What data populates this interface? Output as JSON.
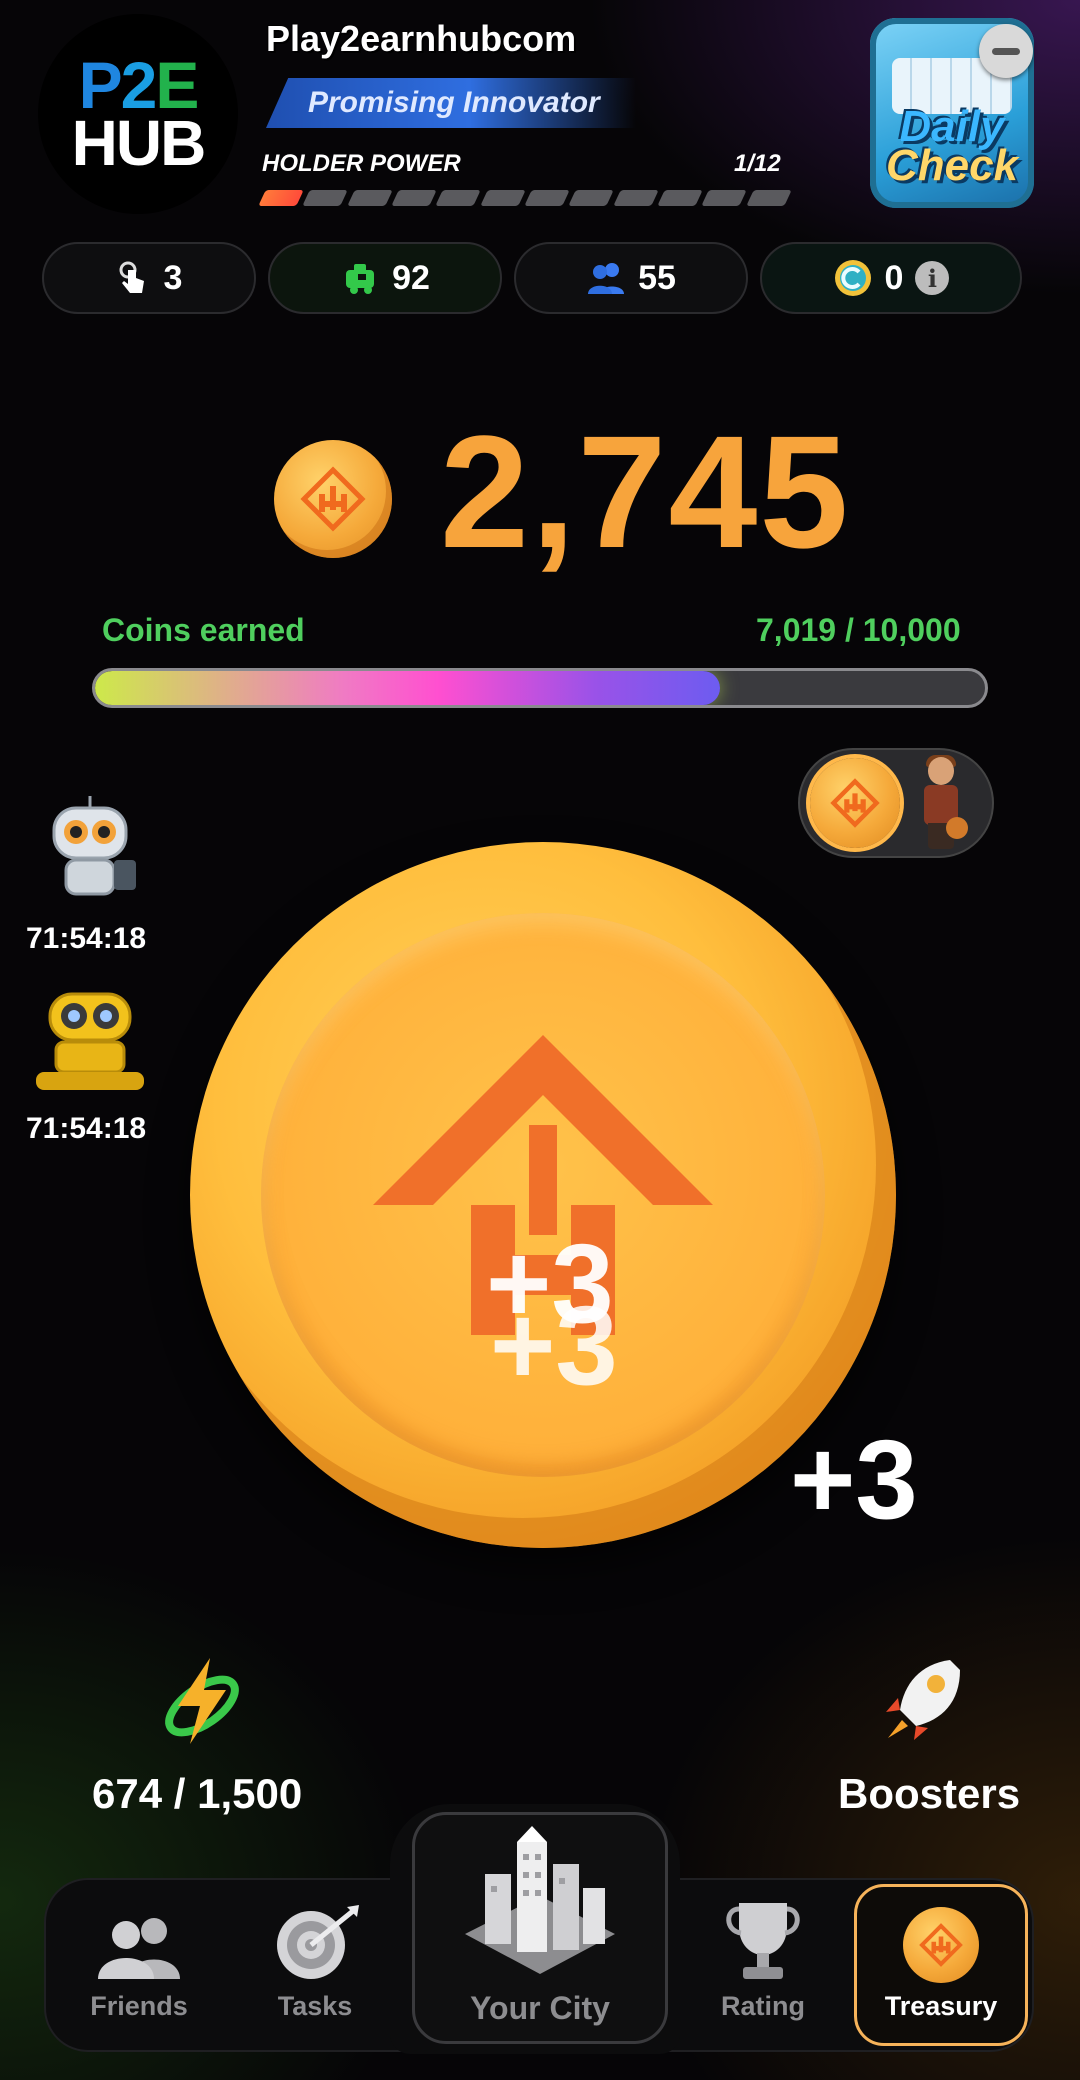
{
  "header": {
    "logo_line1": [
      "P",
      "2",
      "E"
    ],
    "logo_line2": "HUB",
    "username": "Play2earnhubcom",
    "rank": "Promising Innovator",
    "holder_power_label": "HOLDER POWER",
    "holder_power_value": "1/12",
    "holder_power_level": 1,
    "holder_power_max": 12
  },
  "daily_check": {
    "line1": "Daily",
    "line2": "Check"
  },
  "stats": {
    "taps": "3",
    "income": "92",
    "friends": "55",
    "tokens": "0"
  },
  "balance": "2,745",
  "progress": {
    "label": "Coins earned",
    "value_text": "7,019 / 10,000",
    "current": 7019,
    "max": 10000
  },
  "bots": [
    {
      "name": "robot-silver",
      "timer": "71:54:18"
    },
    {
      "name": "robot-yellow",
      "timer": "71:54:18"
    }
  ],
  "tap_popups": [
    "+3",
    "+3",
    "+3"
  ],
  "energy": {
    "text": "674 / 1,500",
    "current": 674,
    "max": 1500
  },
  "boosters_label": "Boosters",
  "nav": {
    "friends": "Friends",
    "tasks": "Tasks",
    "city": "Your City",
    "rating": "Rating",
    "treasury": "Treasury"
  },
  "colors": {
    "balance": "#f7a43c",
    "progress_label": "#4fcf5e",
    "active_tab_border": "#f6b35a",
    "rank_banner": "#2f6ee0"
  },
  "icons": {
    "taps": "hand-tap-icon",
    "income": "robot-income-icon",
    "friends": "people-icon",
    "tokens": "c-token-icon",
    "info": "info-icon",
    "energy": "lightning-icon",
    "boosters": "rocket-icon"
  }
}
